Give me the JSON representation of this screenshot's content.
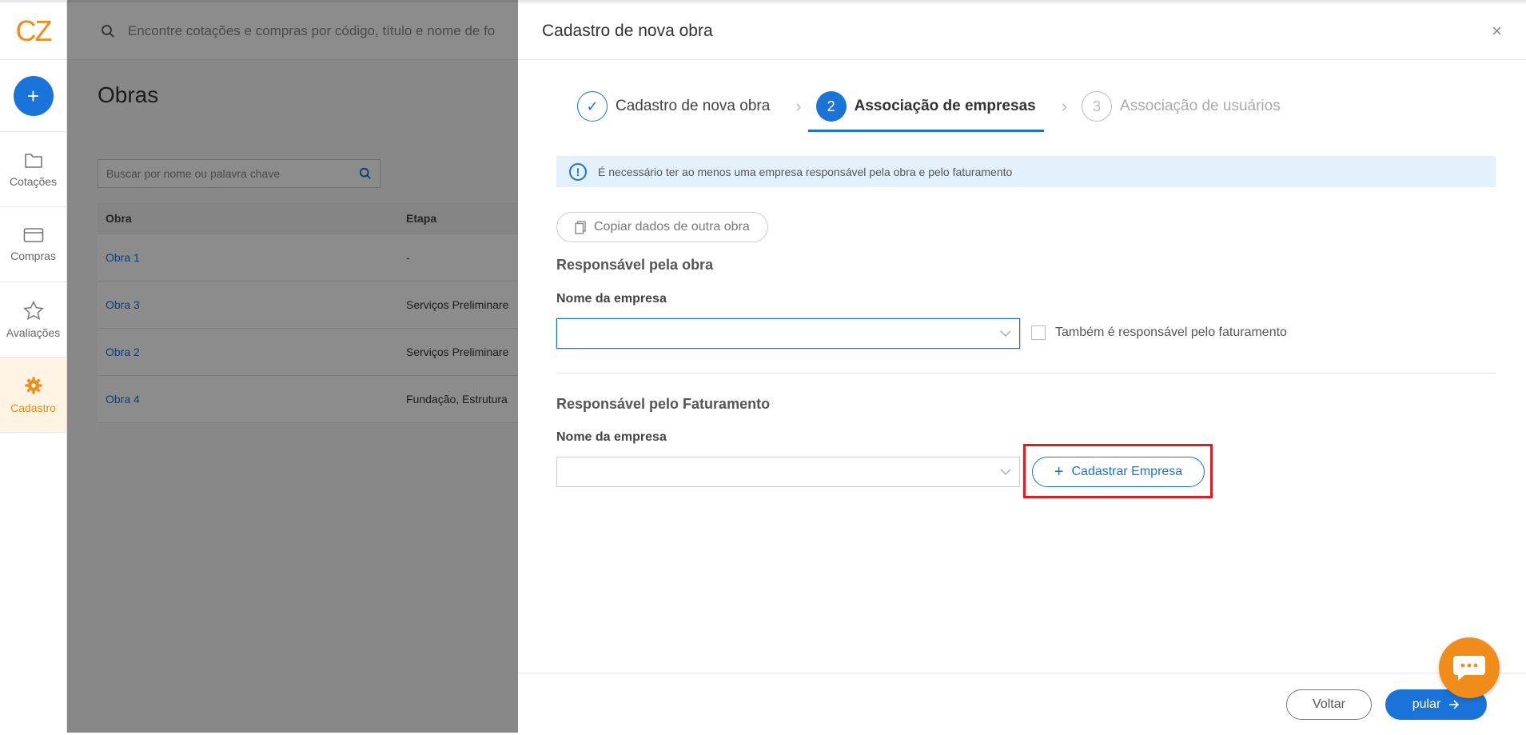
{
  "app": {
    "logo_text": "CZ"
  },
  "sidebar": {
    "add_label": "+",
    "items": [
      {
        "label": "Cotações",
        "icon": "folder-icon"
      },
      {
        "label": "Compras",
        "icon": "card-icon"
      },
      {
        "label": "Avaliações",
        "icon": "star-icon"
      },
      {
        "label": "Cadastro",
        "icon": "gear-icon",
        "active": true
      }
    ]
  },
  "topbar": {
    "search_placeholder": "Encontre cotações e compras por código, título e nome de fo"
  },
  "background_page": {
    "title": "Obras",
    "search_placeholder": "Buscar por nome ou palavra chave",
    "columns": [
      "Obra",
      "Etapa"
    ],
    "rows": [
      {
        "obra": "Obra 1",
        "etapa": "-"
      },
      {
        "obra": "Obra 3",
        "etapa": "Serviços Preliminare"
      },
      {
        "obra": "Obra 2",
        "etapa": "Serviços Preliminare"
      },
      {
        "obra": "Obra 4",
        "etapa": "Fundação, Estrutura"
      }
    ]
  },
  "drawer": {
    "title": "Cadastro de nova obra",
    "close_label": "×",
    "steps": [
      {
        "number": "✓",
        "label": "Cadastro de nova obra",
        "state": "done"
      },
      {
        "number": "2",
        "label": "Associação de empresas",
        "state": "current"
      },
      {
        "number": "3",
        "label": "Associação de usuários",
        "state": "pending"
      }
    ],
    "info_message": "É necessário ter ao menos uma empresa responsável pela obra e pelo faturamento",
    "copy_button": "Copiar dados de outra obra",
    "responsavel_obra": {
      "section_title": "Responsável pela obra",
      "field_label": "Nome da empresa",
      "value": "",
      "checkbox_label": "Também é responsável pelo faturamento"
    },
    "responsavel_faturamento": {
      "section_title": "Responsável pelo Faturamento",
      "field_label": "Nome da empresa",
      "value": "",
      "register_button": "Cadastrar Empresa"
    },
    "footer": {
      "back_label": "Voltar",
      "skip_label": "pular"
    }
  },
  "colors": {
    "primary": "#1a73d9",
    "brand_orange": "#f08c1a",
    "highlight": "#e21c23",
    "info_bg": "#e3f1fc"
  }
}
